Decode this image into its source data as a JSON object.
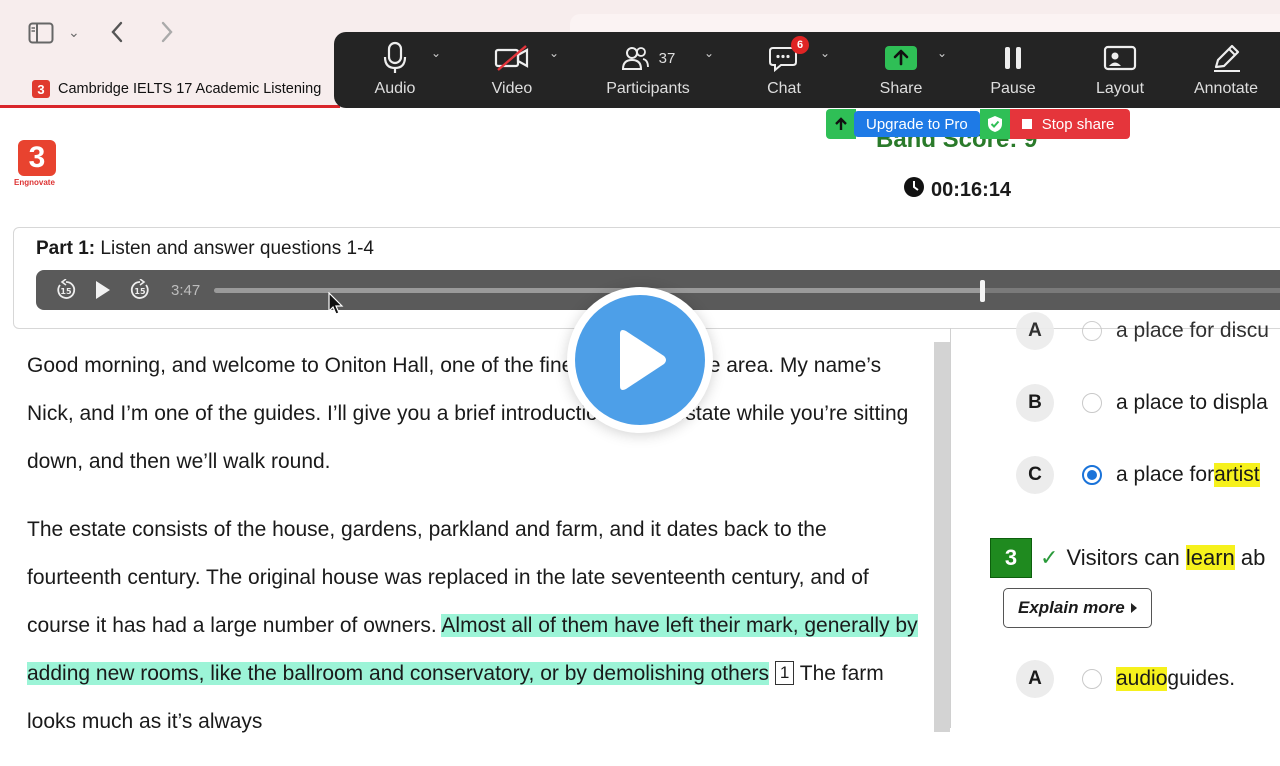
{
  "browser": {
    "tab_title": "Cambridge IELTS 17 Academic Listening",
    "tab_logo": "3"
  },
  "zoom_toolbar": {
    "items": [
      {
        "label": "Audio",
        "icon": "microphone-icon"
      },
      {
        "label": "Video",
        "icon": "video-off-icon"
      },
      {
        "label": "Participants",
        "icon": "participants-icon",
        "count": "37"
      },
      {
        "label": "Chat",
        "icon": "chat-icon",
        "badge": "6"
      },
      {
        "label": "Share",
        "icon": "share-screen-icon"
      },
      {
        "label": "Pause",
        "icon": "pause-icon"
      },
      {
        "label": "Layout",
        "icon": "layout-icon"
      },
      {
        "label": "Annotate",
        "icon": "annotate-pen-icon"
      }
    ],
    "upgrade_label": "Upgrade to Pro",
    "stop_share_label": "Stop share",
    "colors": {
      "bar": "#242424",
      "share": "#2fbf56",
      "upgrade": "#1e7ae6",
      "stop": "#e5353b"
    }
  },
  "header": {
    "logo_text": "Engnovate",
    "band_score": "Band Score: 9",
    "timer": "00:16:14"
  },
  "part": {
    "label": "Part 1:",
    "instruction": "Listen and answer questions 1-4",
    "player": {
      "time": "3:47",
      "progress": 0.71
    }
  },
  "transcript": {
    "p1": "Good morning, and welcome to Oniton Hall, one of the finest estates in the area. My name’s Nick, and I’m one of the guides. I’ll give you a brief introduction to the estate while you’re sitting down, and then we’ll walk round.",
    "p2_plain": "The estate consists of the house, gardens, parkland and farm, and it dates back to the fourteenth century. The original house was replaced in the late seventeenth century, and of course it has had a large number of owners. ",
    "p2_highlight": "Almost all of them have left their mark, generally by adding new rooms, like the ballroom and conservatory, or by demolishing others",
    "p2_qnum": "1",
    "p2_tail": " The farm looks much as it’s always"
  },
  "questions": {
    "q2_options": [
      {
        "letter": "A",
        "text": "a place for discu",
        "selected": false
      },
      {
        "letter": "B",
        "text": "a place to displa",
        "selected": false
      },
      {
        "letter": "C",
        "text_before": "a place for ",
        "text_highlight": "artist",
        "selected": true
      }
    ],
    "q3": {
      "number": "3",
      "check": "✓",
      "text_before": "Visitors can ",
      "text_highlight": "learn",
      "text_after": " ab",
      "explain_label": "Explain more",
      "option_a": {
        "letter": "A",
        "highlight": "audio",
        "text": " guides."
      }
    }
  }
}
